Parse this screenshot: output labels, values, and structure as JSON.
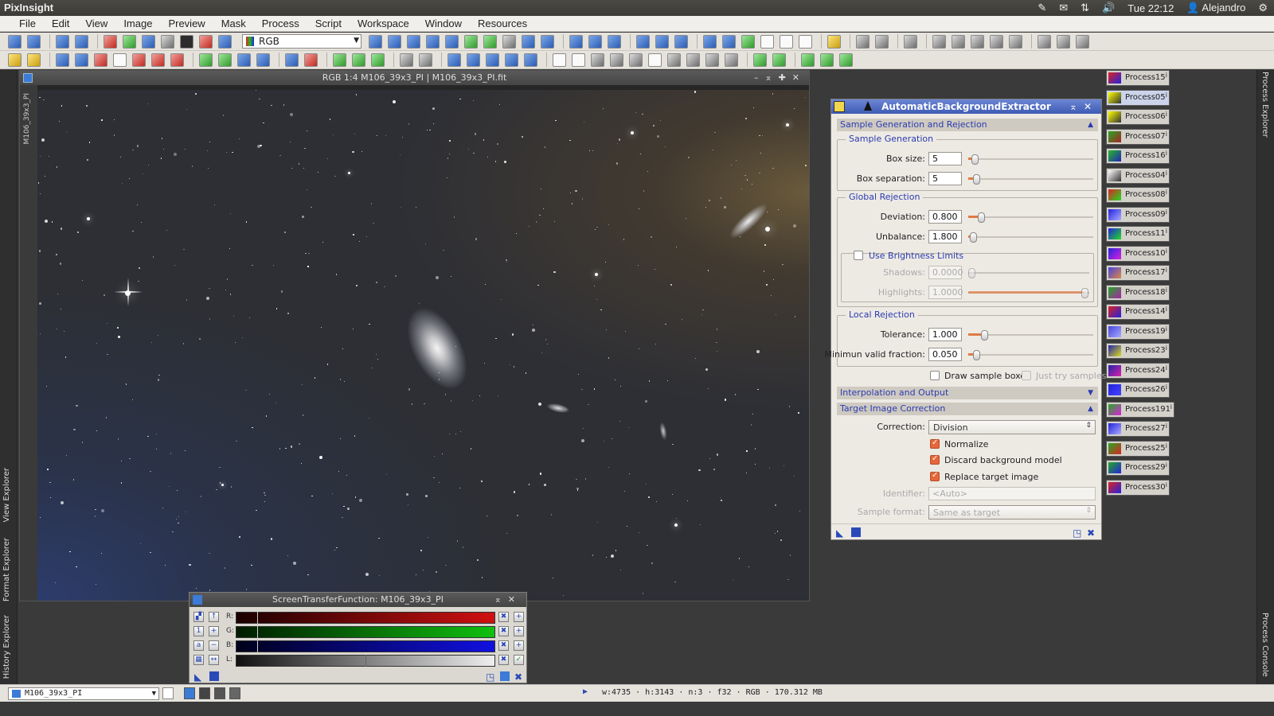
{
  "os": {
    "app_name": "PixInsight",
    "clock": "Tue 22:12",
    "user": "Alejandro"
  },
  "menu": [
    "File",
    "Edit",
    "View",
    "Image",
    "Preview",
    "Mask",
    "Process",
    "Script",
    "Workspace",
    "Window",
    "Resources"
  ],
  "toolbar": {
    "channel_select": "RGB"
  },
  "image_window": {
    "title": "RGB 1:4 M106_39x3_PI | M106_39x3_PI.fit",
    "side_label": "M106_39x3_PI"
  },
  "abe": {
    "title": "AutomaticBackgroundExtractor",
    "sect_sample": "Sample Generation and Rejection",
    "grp_sample_gen": "Sample Generation",
    "box_size_label": "Box size:",
    "box_size": "5",
    "box_sep_label": "Box separation:",
    "box_sep": "5",
    "grp_global": "Global Rejection",
    "deviation_label": "Deviation:",
    "deviation": "0.800",
    "unbalance_label": "Unbalance:",
    "unbalance": "1.800",
    "use_brightness_label": "Use Brightness Limits",
    "shadows_label": "Shadows:",
    "shadows": "0.0000",
    "highlights_label": "Highlights:",
    "highlights": "1.0000",
    "grp_local": "Local Rejection",
    "tolerance_label": "Tolerance:",
    "tolerance": "1.000",
    "min_valid_label": "Minimun valid fraction:",
    "min_valid": "0.050",
    "draw_sample_label": "Draw sample boxes",
    "just_try_label": "Just try samples",
    "sect_interp": "Interpolation and Output",
    "sect_target": "Target Image Correction",
    "correction_label": "Correction:",
    "correction": "Division",
    "normalize_label": "Normalize",
    "discard_label": "Discard background model",
    "replace_label": "Replace target image",
    "identifier_label": "Identifier:",
    "identifier_placeholder": "<Auto>",
    "sample_format_label": "Sample format:",
    "sample_format": "Same as target"
  },
  "processes": [
    "Process15",
    "Process05",
    "Process06",
    "Process07",
    "Process16",
    "Process04",
    "Process08",
    "Process09",
    "Process11",
    "Process10",
    "Process17",
    "Process18",
    "Process14",
    "Process19",
    "Process23",
    "Process24",
    "Process26",
    "Process191",
    "Process27",
    "Process25",
    "Process29",
    "Process30"
  ],
  "process_icon_marker": "i",
  "stf": {
    "title": "ScreenTransferFunction: M106_39x3_PI",
    "r": "R:",
    "g": "G:",
    "b": "B:",
    "l": "L:"
  },
  "docks": {
    "view_explorer": "View Explorer",
    "format_explorer": "Format Explorer",
    "history_explorer": "History Explorer",
    "process_explorer": "Process Explorer",
    "process_console": "Process Console"
  },
  "status": {
    "view": "M106_39x3_PI",
    "info": "w:4735 · h:3143 · n:3 · f32 · RGB · 170.312 MB"
  }
}
